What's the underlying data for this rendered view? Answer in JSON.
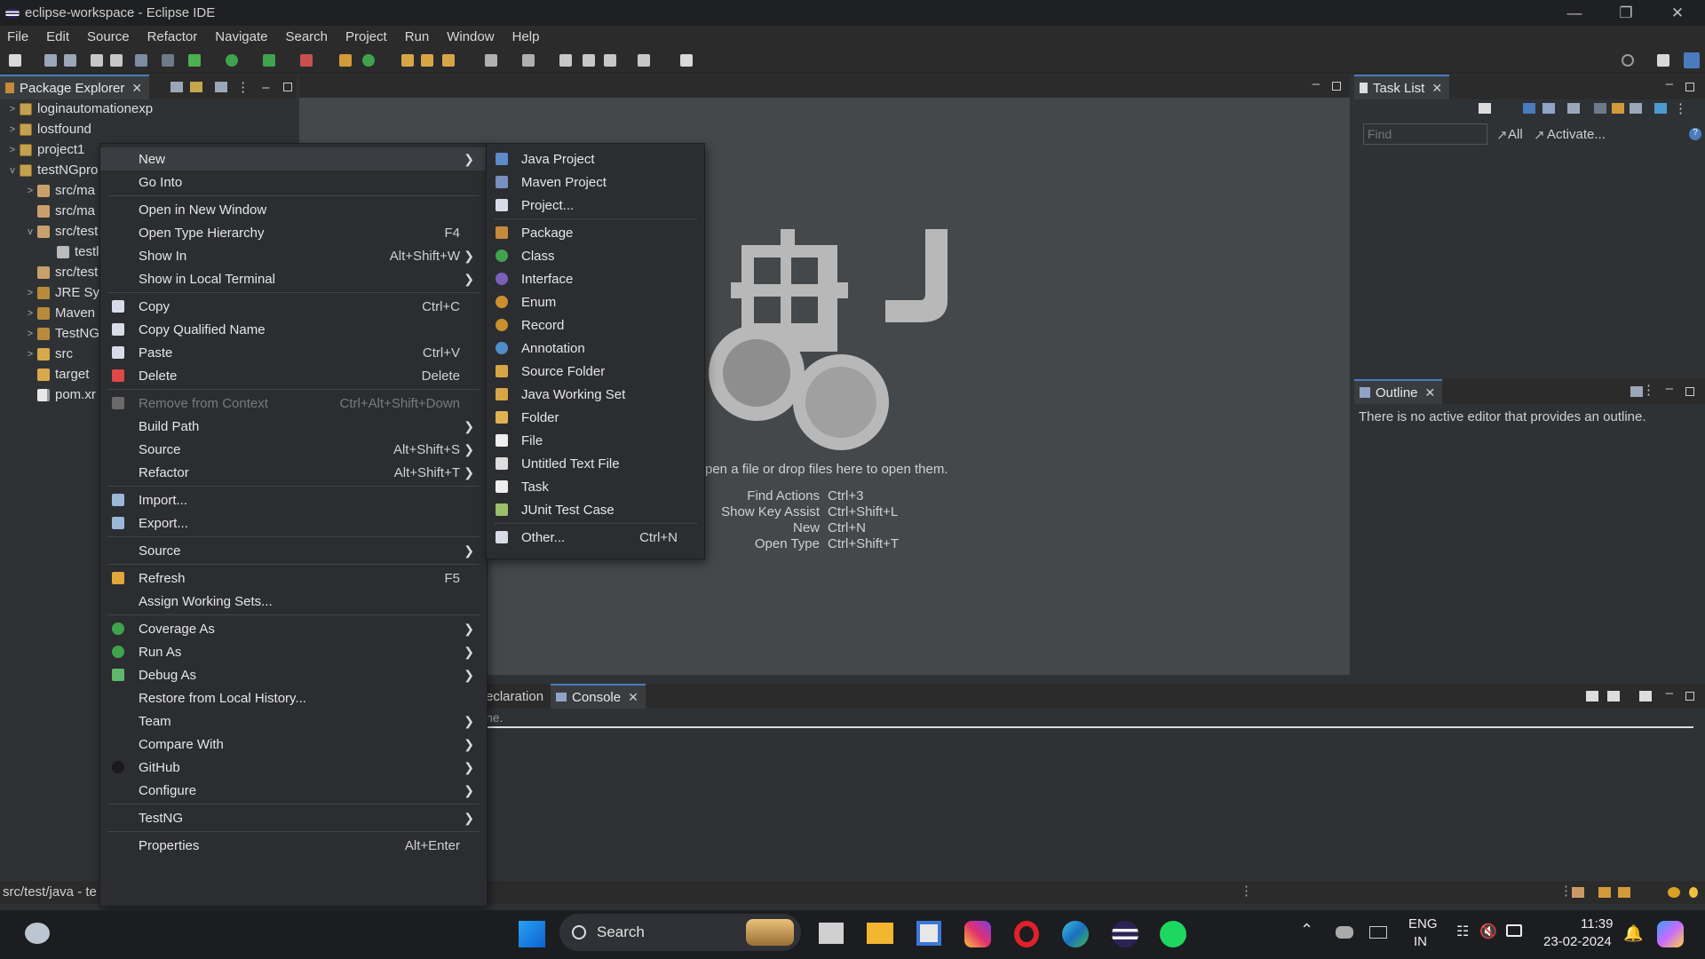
{
  "window": {
    "title": "eclipse-workspace - Eclipse IDE"
  },
  "menubar": [
    "File",
    "Edit",
    "Source",
    "Refactor",
    "Navigate",
    "Search",
    "Project",
    "Run",
    "Window",
    "Help"
  ],
  "package_explorer": {
    "tab_label": "Package Explorer",
    "items": [
      {
        "label": "loginautomationexp",
        "expander": ">"
      },
      {
        "label": "lostfound",
        "expander": ">"
      },
      {
        "label": "project1",
        "expander": ">"
      },
      {
        "label": "testNGpro",
        "expander": "v"
      },
      {
        "label": "src/ma",
        "expander": ">"
      },
      {
        "label": "src/ma",
        "expander": ""
      },
      {
        "label": "src/test",
        "expander": "v"
      },
      {
        "label": "testl",
        "expander": ""
      },
      {
        "label": "src/test",
        "expander": ""
      },
      {
        "label": "JRE Sys",
        "expander": ">"
      },
      {
        "label": "Maven",
        "expander": ">"
      },
      {
        "label": "TestNG",
        "expander": ">"
      },
      {
        "label": "src",
        "expander": ">"
      },
      {
        "label": "target",
        "expander": ""
      },
      {
        "label": "pom.xr",
        "expander": ""
      }
    ]
  },
  "context_menu": {
    "items": [
      {
        "label": "New",
        "shortcut": "",
        "submenu": true,
        "highlight": true
      },
      {
        "label": "Go Into",
        "shortcut": "",
        "submenu": false
      },
      {
        "sep": true
      },
      {
        "label": "Open in New Window",
        "shortcut": "",
        "submenu": false
      },
      {
        "label": "Open Type Hierarchy",
        "shortcut": "F4",
        "submenu": false
      },
      {
        "label": "Show In",
        "shortcut": "Alt+Shift+W",
        "submenu": true
      },
      {
        "label": "Show in Local Terminal",
        "shortcut": "",
        "submenu": true
      },
      {
        "sep": true
      },
      {
        "label": "Copy",
        "shortcut": "Ctrl+C",
        "submenu": false,
        "icon": "copy-icon"
      },
      {
        "label": "Copy Qualified Name",
        "shortcut": "",
        "submenu": false,
        "icon": "copy-qualified-icon"
      },
      {
        "label": "Paste",
        "shortcut": "Ctrl+V",
        "submenu": false,
        "icon": "paste-icon"
      },
      {
        "label": "Delete",
        "shortcut": "Delete",
        "submenu": false,
        "icon": "delete-icon"
      },
      {
        "sep": true
      },
      {
        "label": "Remove from Context",
        "shortcut": "Ctrl+Alt+Shift+Down",
        "submenu": false,
        "disabled": true,
        "icon": "remove-context-icon"
      },
      {
        "label": "Build Path",
        "shortcut": "",
        "submenu": true
      },
      {
        "label": "Source",
        "shortcut": "Alt+Shift+S",
        "submenu": true
      },
      {
        "label": "Refactor",
        "shortcut": "Alt+Shift+T",
        "submenu": true
      },
      {
        "sep": true
      },
      {
        "label": "Import...",
        "shortcut": "",
        "submenu": false,
        "icon": "import-icon"
      },
      {
        "label": "Export...",
        "shortcut": "",
        "submenu": false,
        "icon": "export-icon"
      },
      {
        "sep": true
      },
      {
        "label": "Source",
        "shortcut": "",
        "submenu": true
      },
      {
        "sep": true
      },
      {
        "label": "Refresh",
        "shortcut": "F5",
        "submenu": false,
        "icon": "refresh-icon"
      },
      {
        "label": "Assign Working Sets...",
        "shortcut": "",
        "submenu": false
      },
      {
        "sep": true
      },
      {
        "label": "Coverage As",
        "shortcut": "",
        "submenu": true,
        "icon": "coverage-icon"
      },
      {
        "label": "Run As",
        "shortcut": "",
        "submenu": true,
        "icon": "run-icon"
      },
      {
        "label": "Debug As",
        "shortcut": "",
        "submenu": true,
        "icon": "debug-icon"
      },
      {
        "label": "Restore from Local History...",
        "shortcut": "",
        "submenu": false
      },
      {
        "label": "Team",
        "shortcut": "",
        "submenu": true
      },
      {
        "label": "Compare With",
        "shortcut": "",
        "submenu": true
      },
      {
        "label": "GitHub",
        "shortcut": "",
        "submenu": true,
        "icon": "github-icon"
      },
      {
        "label": "Configure",
        "shortcut": "",
        "submenu": true
      },
      {
        "sep": true
      },
      {
        "label": "TestNG",
        "shortcut": "",
        "submenu": true
      },
      {
        "sep": true
      },
      {
        "label": "Properties",
        "shortcut": "Alt+Enter",
        "submenu": false
      }
    ]
  },
  "new_submenu": {
    "items": [
      {
        "label": "Java Project",
        "shortcut": "",
        "icon": "java-project-icon",
        "color": "#5b8bc9"
      },
      {
        "label": "Maven Project",
        "shortcut": "",
        "icon": "maven-project-icon",
        "color": "#7a8fc0"
      },
      {
        "label": "Project...",
        "shortcut": "",
        "icon": "project-icon",
        "color": "#d7dce8"
      },
      {
        "sep": true
      },
      {
        "label": "Package",
        "shortcut": "",
        "icon": "package-icon",
        "color": "#c48a3a"
      },
      {
        "label": "Class",
        "shortcut": "",
        "icon": "class-icon",
        "color": "#3fa34d"
      },
      {
        "label": "Interface",
        "shortcut": "",
        "icon": "interface-icon",
        "color": "#7b5fb8"
      },
      {
        "label": "Enum",
        "shortcut": "",
        "icon": "enum-icon",
        "color": "#c9902d"
      },
      {
        "label": "Record",
        "shortcut": "",
        "icon": "record-icon",
        "color": "#c9902d"
      },
      {
        "label": "Annotation",
        "shortcut": "",
        "icon": "annotation-icon",
        "color": "#4f8fc9"
      },
      {
        "label": "Source Folder",
        "shortcut": "",
        "icon": "source-folder-icon",
        "color": "#d6a646"
      },
      {
        "label": "Java Working Set",
        "shortcut": "",
        "icon": "working-set-icon",
        "color": "#d6a646"
      },
      {
        "label": "Folder",
        "shortcut": "",
        "icon": "folder-icon",
        "color": "#e0b252"
      },
      {
        "label": "File",
        "shortcut": "",
        "icon": "file-icon",
        "color": "#eeeeee"
      },
      {
        "label": "Untitled Text File",
        "shortcut": "",
        "icon": "text-file-icon",
        "color": "#dddddd"
      },
      {
        "label": "Task",
        "shortcut": "",
        "icon": "task-icon",
        "color": "#eeeeee"
      },
      {
        "label": "JUnit Test Case",
        "shortcut": "",
        "icon": "junit-icon",
        "color": "#9bbf6a"
      },
      {
        "sep": true
      },
      {
        "label": "Other...",
        "shortcut": "Ctrl+N",
        "icon": "other-icon",
        "color": "#d7dce8"
      }
    ]
  },
  "editor": {
    "drop_hint": "pen a file or drop files here to open them.",
    "shortcuts": [
      {
        "name": "Find Actions",
        "keys": "Ctrl+3"
      },
      {
        "name": "Show Key Assist",
        "keys": "Ctrl+Shift+L"
      },
      {
        "name": "New",
        "keys": "Ctrl+N"
      },
      {
        "name": "Open Type",
        "keys": "Ctrl+Shift+T"
      }
    ]
  },
  "task_list": {
    "tab_label": "Task List",
    "find_placeholder": "Find",
    "all_label": "All",
    "activate_label": "Activate..."
  },
  "outline": {
    "tab_label": "Outline",
    "message": "There is no active editor that provides an outline."
  },
  "bottom_panel": {
    "tabs": [
      "eclaration",
      "Console"
    ],
    "active": "Console",
    "content": "ne."
  },
  "statusbar": {
    "text": "src/test/java - te"
  },
  "taskbar": {
    "search_label": "Search",
    "lang_top": "ENG",
    "lang_bottom": "IN",
    "time": "11:39",
    "date": "23-02-2024"
  },
  "colors": {
    "accent": "#4a7bbd",
    "menu_bg": "#2b2d30",
    "editor_bg": "#45484a"
  }
}
